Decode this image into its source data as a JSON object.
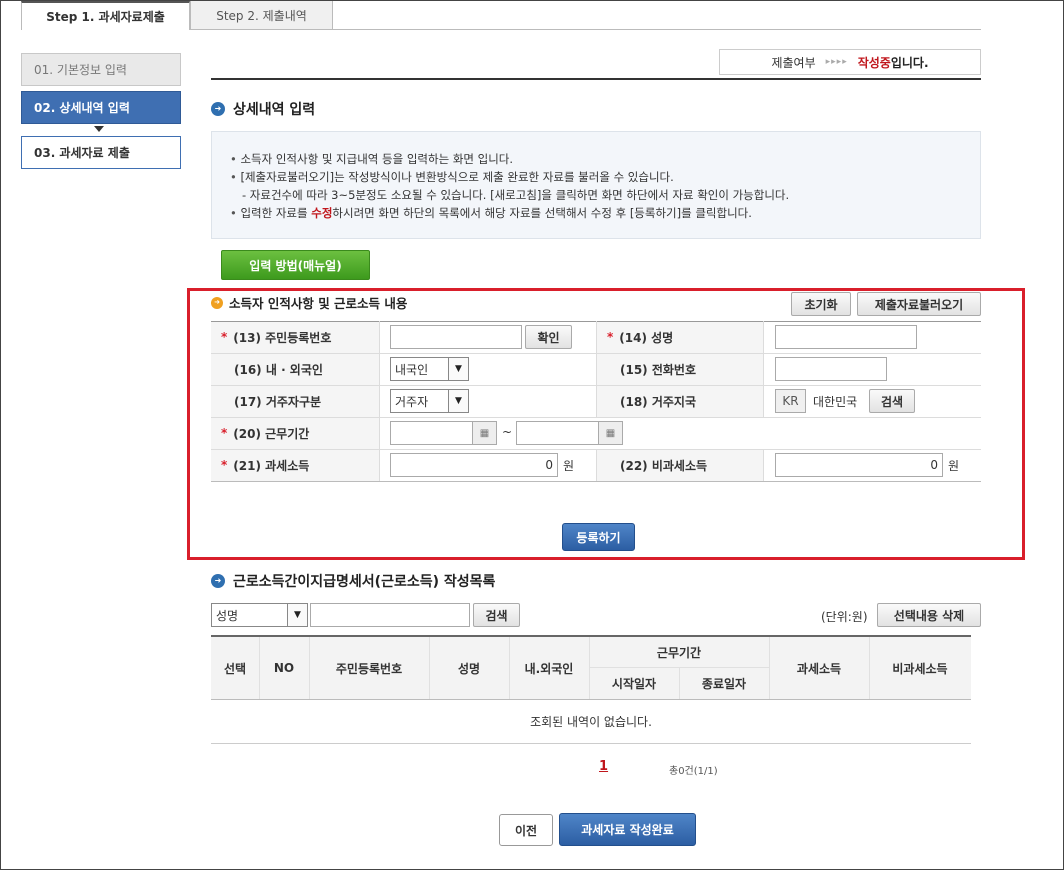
{
  "steps": [
    {
      "label": "Step 1. 과세자료제출"
    },
    {
      "label": "Step 2. 제출내역"
    }
  ],
  "nav": [
    {
      "label": "01. 기본정보 입력"
    },
    {
      "label": "02. 상세내역 입력"
    },
    {
      "label": "03. 과세자료 제출"
    }
  ],
  "status": {
    "label": "제출여부",
    "arrows": "▸▸▸▸",
    "state": "작성중",
    "suffix": "입니다."
  },
  "detail": {
    "title": "상세내역 입력"
  },
  "info": {
    "lines": [
      "소득자 인적사항 및 지급내역 등을 입력하는 화면 입니다.",
      "[제출자료불러오기]는 작성방식이나 변환방식으로 제출 완료한 자료를 불러올 수 있습니다.",
      "- 자료건수에 따라 3~5분정도 소요될 수 있습니다. [새로고침]을 클릭하면 화면 하단에서 자료 확인이 가능합니다."
    ],
    "line4_pre": "입력한 자료를 ",
    "line4_red": "수정",
    "line4_post": "하시려면 화면 하단의 목록에서 해당 자료를 선택해서 수정 후 [등록하기]를 클릭합니다."
  },
  "manual_button": "입력 방법(매뉴얼)",
  "form": {
    "title": "소득자 인적사항 및 근로소득 내용",
    "reset_button": "초기화",
    "load_button": "제출자료불러오기",
    "star": "*",
    "fields": {
      "rrn": {
        "label": "(13) 주민등록번호",
        "value": "",
        "confirm": "확인"
      },
      "name": {
        "label": "(14) 성명",
        "value": ""
      },
      "nationality": {
        "label": "(16) 내 · 외국인",
        "value": "내국인"
      },
      "phone": {
        "label": "(15) 전화번호",
        "value": ""
      },
      "residence": {
        "label": "(17) 거주자구분",
        "value": "거주자"
      },
      "country": {
        "label": "(18) 거주지국",
        "code": "KR",
        "name": "대한민국",
        "search": "검색"
      },
      "period": {
        "label": "(20) 근무기간",
        "start": "",
        "end": "",
        "tilde": "~"
      },
      "taxable": {
        "label": "(21) 과세소득",
        "value": "0",
        "unit": "원"
      },
      "nontaxable": {
        "label": "(22) 비과세소득",
        "value": "0",
        "unit": "원"
      }
    },
    "register_button": "등록하기"
  },
  "list": {
    "title": "근로소득간이지급명세서(근로소득) 작성목록",
    "filter_value": "성명",
    "search_value": "",
    "search_button": "검색",
    "unit_label": "(단위:원)",
    "delete_button": "선택내용 삭제",
    "columns": {
      "select": "선택",
      "no": "NO",
      "rrn": "주민등록번호",
      "name": "성명",
      "nationality": "내.외국인",
      "period": "근무기간",
      "start": "시작일자",
      "end": "종료일자",
      "taxable": "과세소득",
      "nontaxable": "비과세소득"
    },
    "empty": "조회된 내역이 없습니다.",
    "page": "1",
    "total": "총0건(1/1)"
  },
  "footer": {
    "prev_button": "이전",
    "complete_button": "과세자료 작성완료"
  }
}
